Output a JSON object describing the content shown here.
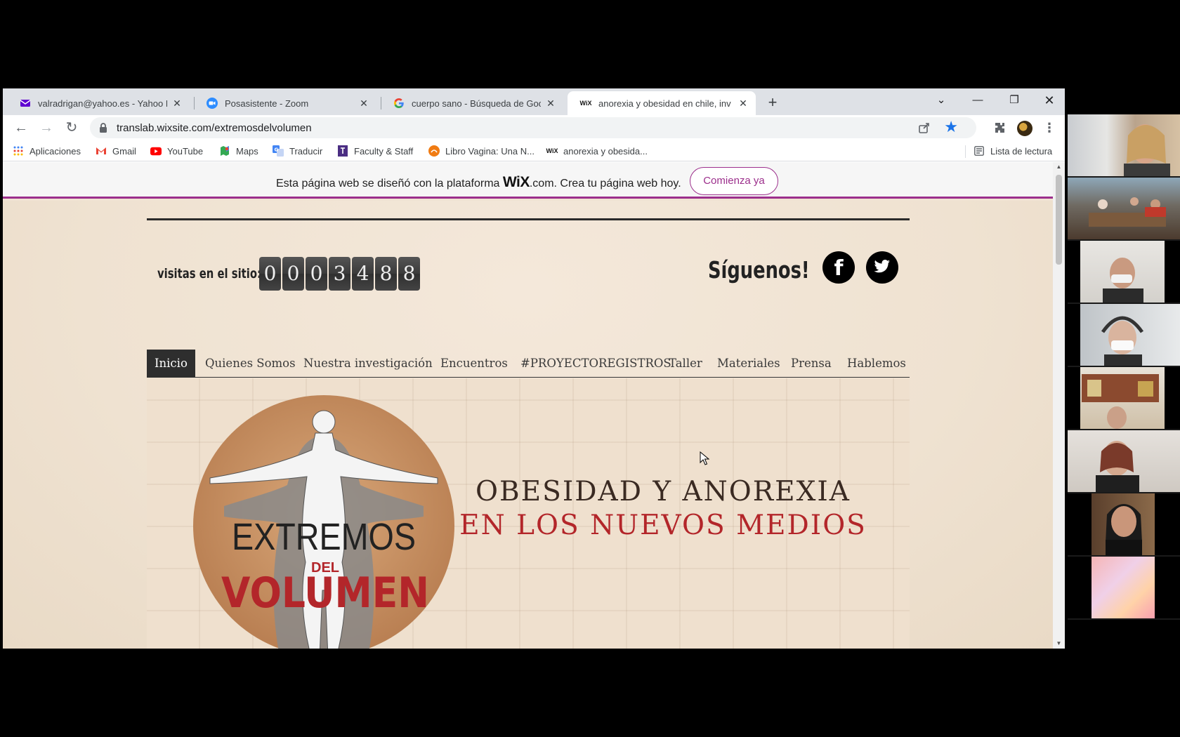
{
  "browser": {
    "tabs": [
      {
        "title": "valradrigan@yahoo.es - Yahoo M",
        "icon": "mail-icon",
        "active": false
      },
      {
        "title": "Posasistente - Zoom",
        "icon": "zoom-icon",
        "active": false
      },
      {
        "title": "cuerpo sano - Búsqueda de Goo",
        "icon": "google-icon",
        "active": false
      },
      {
        "title": "anorexia y obesidad en chile, inv",
        "icon": "wix-icon",
        "active": true
      }
    ],
    "new_tab": "+",
    "url": "translab.wixsite.com/extremosdelvolumen",
    "bookmarks": [
      {
        "label": "Aplicaciones",
        "icon": "apps-grid-icon"
      },
      {
        "label": "Gmail",
        "icon": "gmail-icon"
      },
      {
        "label": "YouTube",
        "icon": "youtube-icon"
      },
      {
        "label": "Maps",
        "icon": "maps-icon"
      },
      {
        "label": "Traducir",
        "icon": "translate-icon"
      },
      {
        "label": "Faculty & Staff",
        "icon": "faculty-icon"
      },
      {
        "label": "Libro Vagina: Una N...",
        "icon": "book-icon"
      },
      {
        "label": "anorexia y obesida...",
        "icon": "wix-icon"
      }
    ],
    "reading_list": "Lista de lectura"
  },
  "wix_banner": {
    "text_before": "Esta página web se diseñó con la plataforma ",
    "brand": "WiX",
    "text_after": ".com. Crea tu página web hoy.",
    "cta": "Comienza ya"
  },
  "site": {
    "visits_label": "visitas en el sitio:",
    "counter_digits": [
      "0",
      "0",
      "0",
      "3",
      "4",
      "8",
      "8"
    ],
    "follow_label": "Síguenos!",
    "social": [
      {
        "name": "facebook",
        "glyph": "f"
      },
      {
        "name": "twitter",
        "glyph": ""
      }
    ],
    "menu": [
      {
        "label": "Inicio",
        "active": true
      },
      {
        "label": "Quienes Somos",
        "active": false
      },
      {
        "label": "Nuestra investigación",
        "active": false
      },
      {
        "label": "Encuentros",
        "active": false
      },
      {
        "label": "#PROYECTOREGISTROS",
        "active": false
      },
      {
        "label": "Taller",
        "active": false
      },
      {
        "label": "Materiales",
        "active": false
      },
      {
        "label": "Prensa",
        "active": false
      },
      {
        "label": "Hablemos",
        "active": false
      }
    ],
    "logo": {
      "line1": "EXTREMOS",
      "line2": "DEL",
      "line3": "VOLUMEN"
    },
    "headline": {
      "line1": "OBESIDAD Y ANOREXIA",
      "line2": "EN LOS NUEVOS MEDIOS"
    }
  },
  "colors": {
    "wix_accent": "#9c2f8c",
    "headline_red": "#b3262a",
    "page_bg": "#f0e3d3",
    "menu_active": "#2e2e2e"
  },
  "zoom_participants": 8
}
